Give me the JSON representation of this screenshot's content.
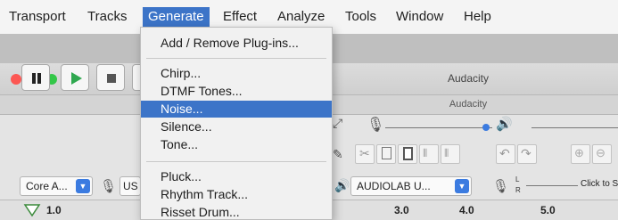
{
  "menubar": {
    "items": [
      "Transport",
      "Tracks",
      "Generate",
      "Effect",
      "Analyze",
      "Tools",
      "Window",
      "Help"
    ],
    "active": "Generate"
  },
  "window": {
    "title": "Audacity",
    "tab_title": "Audacity"
  },
  "generate_menu": {
    "groups": [
      [
        "Add / Remove Plug-ins..."
      ],
      [
        "Chirp...",
        "DTMF Tones...",
        "Noise...",
        "Silence...",
        "Tone..."
      ],
      [
        "Pluck...",
        "Rhythm Track...",
        "Risset Drum..."
      ]
    ],
    "highlighted": "Noise..."
  },
  "transport": {
    "buttons": [
      "pause-icon",
      "play-icon",
      "stop-icon"
    ]
  },
  "devices": {
    "host": "Core A...",
    "recording_device": "US",
    "playback_device": "AUDIOLAB U...",
    "channel_labels": [
      "L",
      "R"
    ],
    "click_to_start": "Click to Start"
  },
  "timeline": {
    "ticks": [
      "1.0",
      "3.0",
      "4.0",
      "5.0"
    ]
  },
  "colors": {
    "highlight": "#3c74c8",
    "play_green": "#2fa84f",
    "dropdown_blue": "#3b7be0"
  }
}
